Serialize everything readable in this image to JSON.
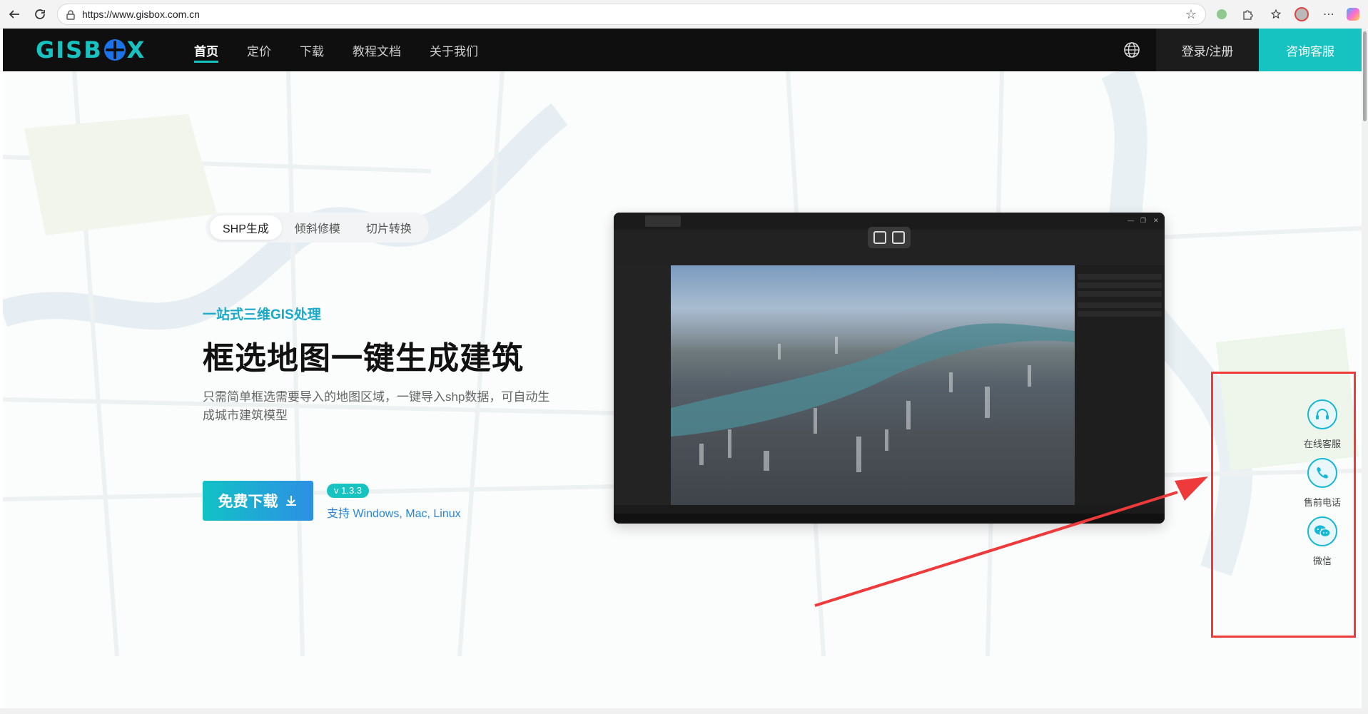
{
  "browser": {
    "url": "https://www.gisbox.com.cn"
  },
  "header": {
    "logo": "GISBOX",
    "nav": [
      "首页",
      "定价",
      "下载",
      "教程文档",
      "关于我们"
    ],
    "active_index": 0,
    "login_label": "登录/注册",
    "consult_label": "咨询客服"
  },
  "hero": {
    "tabs": [
      "SHP生成",
      "倾斜修模",
      "切片转换"
    ],
    "active_tab": 0,
    "eyebrow": "一站式三维GIS处理",
    "title": "框选地图一键生成建筑",
    "description": "只需简单框选需要导入的地图区域，一键导入shp数据，可自动生成城市建筑模型",
    "download_label": "免费下载",
    "version": "v 1.3.3",
    "platforms": "支持 Windows, Mac, Linux"
  },
  "float_widget": {
    "items": [
      {
        "label": "在线客服",
        "icon": "headset-icon"
      },
      {
        "label": "售前电话",
        "icon": "phone-icon"
      },
      {
        "label": "微信",
        "icon": "wechat-icon"
      }
    ]
  },
  "colors": {
    "accent": "#17c3c1",
    "header_bg": "#0f0f0f",
    "annotation": "#ee3a3a",
    "link": "#2a86d6"
  }
}
